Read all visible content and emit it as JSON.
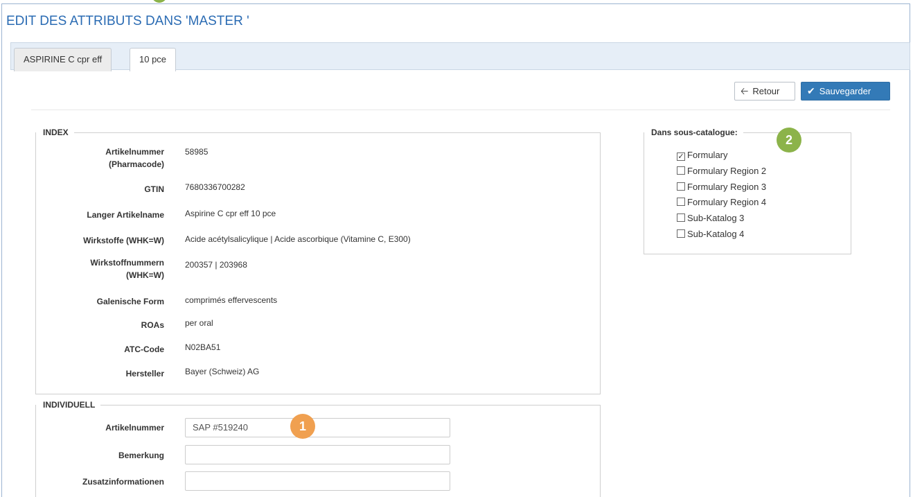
{
  "page": {
    "title": "EDIT DES ATTRIBUTS DANS 'MASTER '"
  },
  "tabs": [
    {
      "label": "ASPIRINE C cpr eff"
    },
    {
      "label": "10 pce"
    }
  ],
  "actions": {
    "back_label": "Retour",
    "save_label": "Sauvegarder"
  },
  "index": {
    "legend": "INDEX",
    "rows": [
      {
        "label": "Artikelnummer\n(Pharmacode)",
        "value": "58985"
      },
      {
        "label": "GTIN",
        "value": "7680336700282"
      },
      {
        "label": "Langer Artikelname",
        "value": "Aspirine C cpr eff 10 pce"
      },
      {
        "label": "Wirkstoffe (WHK=W)",
        "value": "Acide acétylsalicylique | Acide ascorbique (Vitamine C, E300)"
      },
      {
        "label": "Wirkstoffnummern\n(WHK=W)",
        "value": "200357 | 203968"
      },
      {
        "label": "Galenische Form",
        "value": "comprimés effervescents"
      },
      {
        "label": "ROAs",
        "value": "per oral"
      },
      {
        "label": "ATC-Code",
        "value": "N02BA51"
      },
      {
        "label": "Hersteller",
        "value": "Bayer (Schweiz) AG"
      }
    ]
  },
  "individuell": {
    "legend": "INDIVIDUELL",
    "fields": [
      {
        "label": "Artikelnummer",
        "value": "SAP #519240"
      },
      {
        "label": "Bemerkung",
        "value": ""
      },
      {
        "label": "Zusatzinformationen",
        "value": ""
      }
    ]
  },
  "catalog": {
    "legend": "Dans sous-catalogue:",
    "items": [
      {
        "label": "Formulary",
        "checked": true
      },
      {
        "label": "Formulary Region 2",
        "checked": false
      },
      {
        "label": "Formulary Region 3",
        "checked": false
      },
      {
        "label": "Formulary Region 4",
        "checked": false
      },
      {
        "label": "Sub-Katalog 3",
        "checked": false
      },
      {
        "label": "Sub-Katalog 4",
        "checked": false
      }
    ]
  },
  "badges": {
    "one": "1",
    "two": "2"
  },
  "icons": {
    "back": "arrow-left-icon",
    "save": "check-icon"
  },
  "colors": {
    "title": "#2a6bb3",
    "primary_button": "#337ab7",
    "badge_orange": "#f0a050",
    "badge_green": "#8cb34a"
  }
}
